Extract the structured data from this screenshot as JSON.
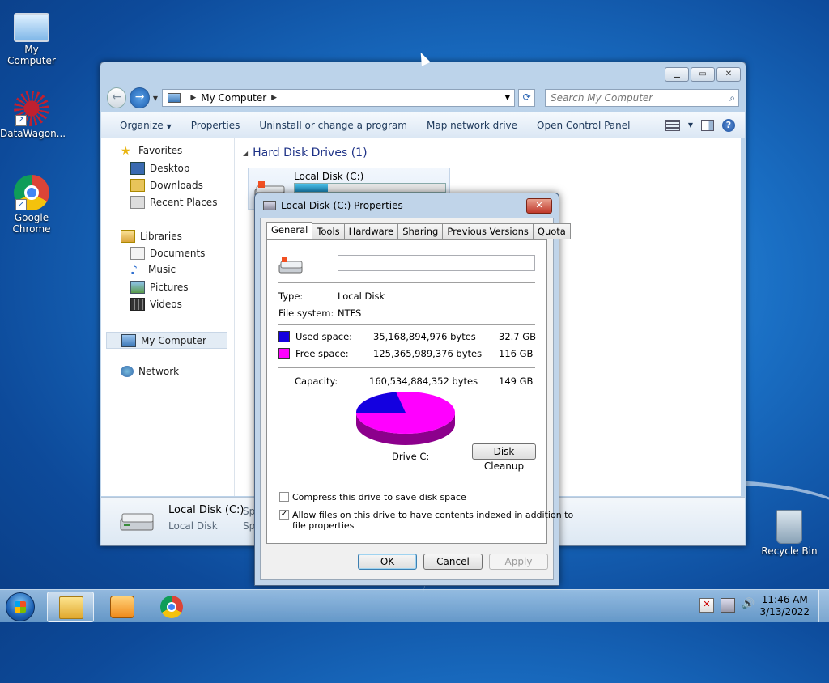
{
  "desktop": {
    "icons": [
      {
        "label": "My Computer"
      },
      {
        "label": "DataWagon..."
      },
      {
        "label": "Google Chrome"
      },
      {
        "label": "Recycle Bin"
      }
    ]
  },
  "explorer": {
    "address": {
      "location": "My Computer"
    },
    "search": {
      "placeholder": "Search My Computer"
    },
    "commands": [
      "Organize",
      "Properties",
      "Uninstall or change a program",
      "Map network drive",
      "Open Control Panel"
    ],
    "nav": {
      "favorites": "Favorites",
      "desktop": "Desktop",
      "downloads": "Downloads",
      "recent_places": "Recent Places",
      "libraries": "Libraries",
      "documents": "Documents",
      "music": "Music",
      "pictures": "Pictures",
      "videos": "Videos",
      "my_computer": "My Computer",
      "network": "Network"
    },
    "group_title": "Hard Disk Drives (1)",
    "drive": {
      "name": "Local Disk (C:)",
      "used_fraction": 0.22
    },
    "details": {
      "name": "Local Disk (C:)",
      "type": "Local Disk",
      "extra1": "Spa",
      "extra2": "Spa"
    }
  },
  "dialog": {
    "title": "Local Disk (C:) Properties",
    "tabs": [
      "General",
      "Tools",
      "Hardware",
      "Sharing",
      "Previous Versions",
      "Quota"
    ],
    "label_value": "",
    "type_label": "Type:",
    "type_value": "Local Disk",
    "fs_label": "File system:",
    "fs_value": "NTFS",
    "used_label": "Used space:",
    "used_bytes": "35,168,894,976 bytes",
    "used_gb": "32.7 GB",
    "free_label": "Free space:",
    "free_bytes": "125,365,989,376 bytes",
    "free_gb": "116 GB",
    "capacity_label": "Capacity:",
    "capacity_bytes": "160,534,884,352 bytes",
    "capacity_gb": "149 GB",
    "drive_caption": "Drive C:",
    "disk_cleanup": "Disk Cleanup",
    "compress_label": "Compress this drive to save disk space",
    "index_label_1": "Allow files on this drive to have contents indexed in addition to",
    "index_label_2": "file properties",
    "ok": "OK",
    "cancel": "Cancel",
    "apply": "Apply",
    "colors": {
      "used": "#1400e0",
      "free": "#ff00ff"
    }
  },
  "taskbar": {
    "time": "11:46 AM",
    "date": "3/13/2022"
  }
}
